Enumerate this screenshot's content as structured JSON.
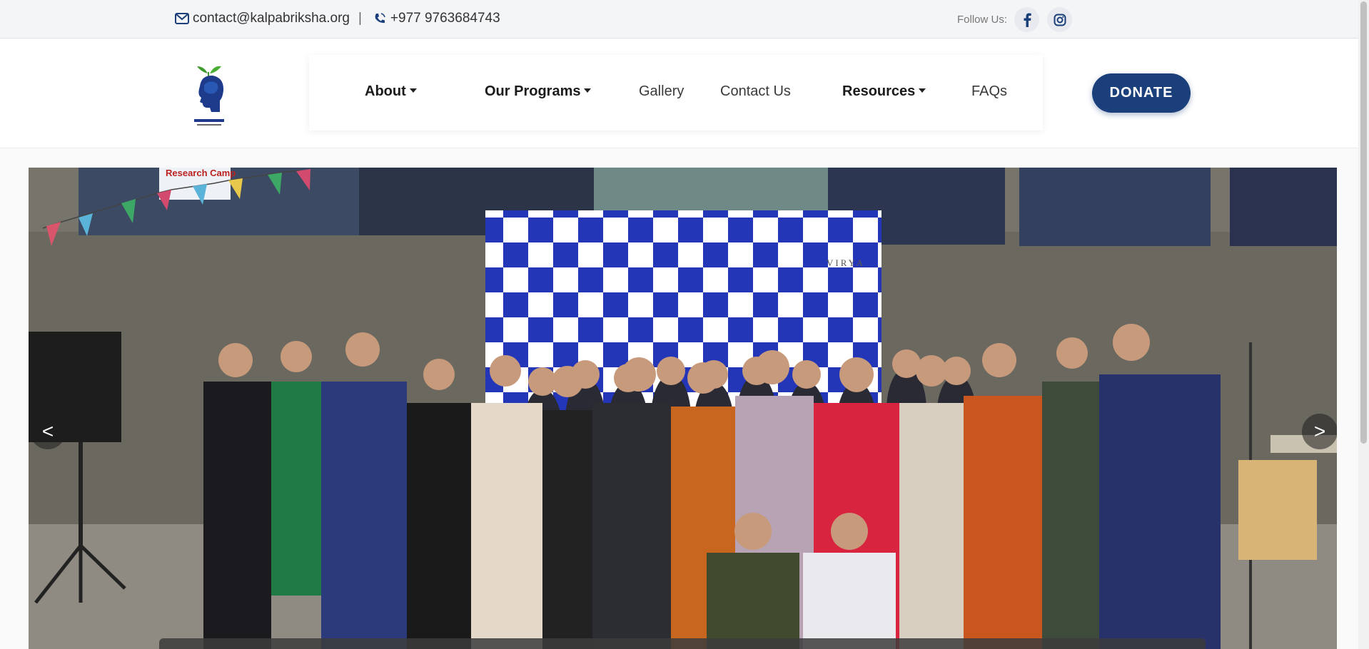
{
  "topbar": {
    "email": "contact@kalpabriksha.org",
    "separator": "|",
    "phone": "+977 9763684743",
    "follow_label": "Follow Us:",
    "social_icons": [
      "facebook-icon",
      "instagram-icon"
    ]
  },
  "header": {
    "logo_icon": "kalpabriksha-logo",
    "nav": {
      "about": "About",
      "programs": "Our Programs",
      "gallery": "Gallery",
      "contact": "Contact Us",
      "resources": "Resources",
      "faqs": "FAQs"
    },
    "donate_label": "DONATE"
  },
  "slider": {
    "prev_label": "<",
    "next_label": ">",
    "banner_text": "Research Camp",
    "backdrop_text": "VIRYA"
  },
  "colors": {
    "brand_blue": "#1a3f7a",
    "topbar_bg": "#f4f5f7"
  }
}
